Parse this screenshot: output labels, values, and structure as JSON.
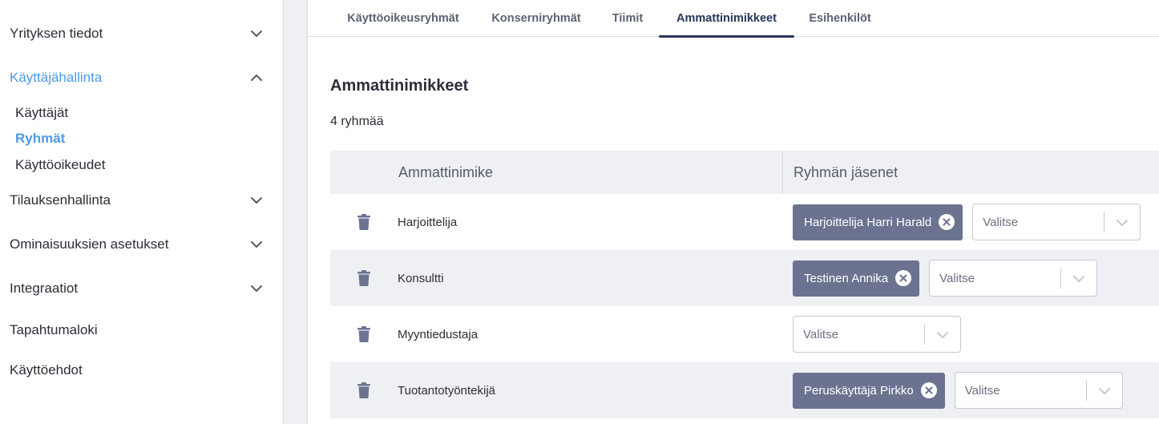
{
  "sidebar": {
    "items": [
      {
        "label": "Yrityksen tiedot",
        "icon": "chevron-down-icon"
      },
      {
        "label": "Käyttäjähallinta",
        "icon": "chevron-up-icon",
        "active": true
      },
      {
        "label": "Tilauksenhallinta",
        "icon": "chevron-down-icon"
      },
      {
        "label": "Ominaisuuksien asetukset",
        "icon": "chevron-down-icon"
      },
      {
        "label": "Integraatiot",
        "icon": "chevron-down-icon"
      },
      {
        "label": "Tapahtumaloki"
      },
      {
        "label": "Käyttöehdot"
      }
    ],
    "subitems": [
      {
        "label": "Käyttäjät"
      },
      {
        "label": "Ryhmät",
        "active": true
      },
      {
        "label": "Käyttöoikeudet"
      }
    ]
  },
  "tabs": [
    {
      "label": "Käyttöoikeusryhmät"
    },
    {
      "label": "Konserniryhmät"
    },
    {
      "label": "Tiimit"
    },
    {
      "label": "Ammattinimikkeet",
      "active": true
    },
    {
      "label": "Esihenkilöt"
    }
  ],
  "main": {
    "title": "Ammattinimikkeet",
    "count": "4 ryhmää"
  },
  "table": {
    "headers": [
      "Ammattinimike",
      "Ryhmän jäsenet"
    ],
    "select_placeholder": "Valitse",
    "rows": [
      {
        "title": "Harjoittelija",
        "members": [
          "Harjoittelija Harri Harald"
        ]
      },
      {
        "title": "Konsultti",
        "members": [
          "Testinen Annika"
        ]
      },
      {
        "title": "Myyntiedustaja",
        "members": []
      },
      {
        "title": "Tuotantotyöntekijä",
        "members": [
          "Peruskäyttäjä Pirkko"
        ]
      }
    ]
  },
  "colors": {
    "accent": "#4d9ae8",
    "tab_active": "#27365a",
    "chip_bg": "#6c7390",
    "row_alt": "#eef0f4"
  }
}
